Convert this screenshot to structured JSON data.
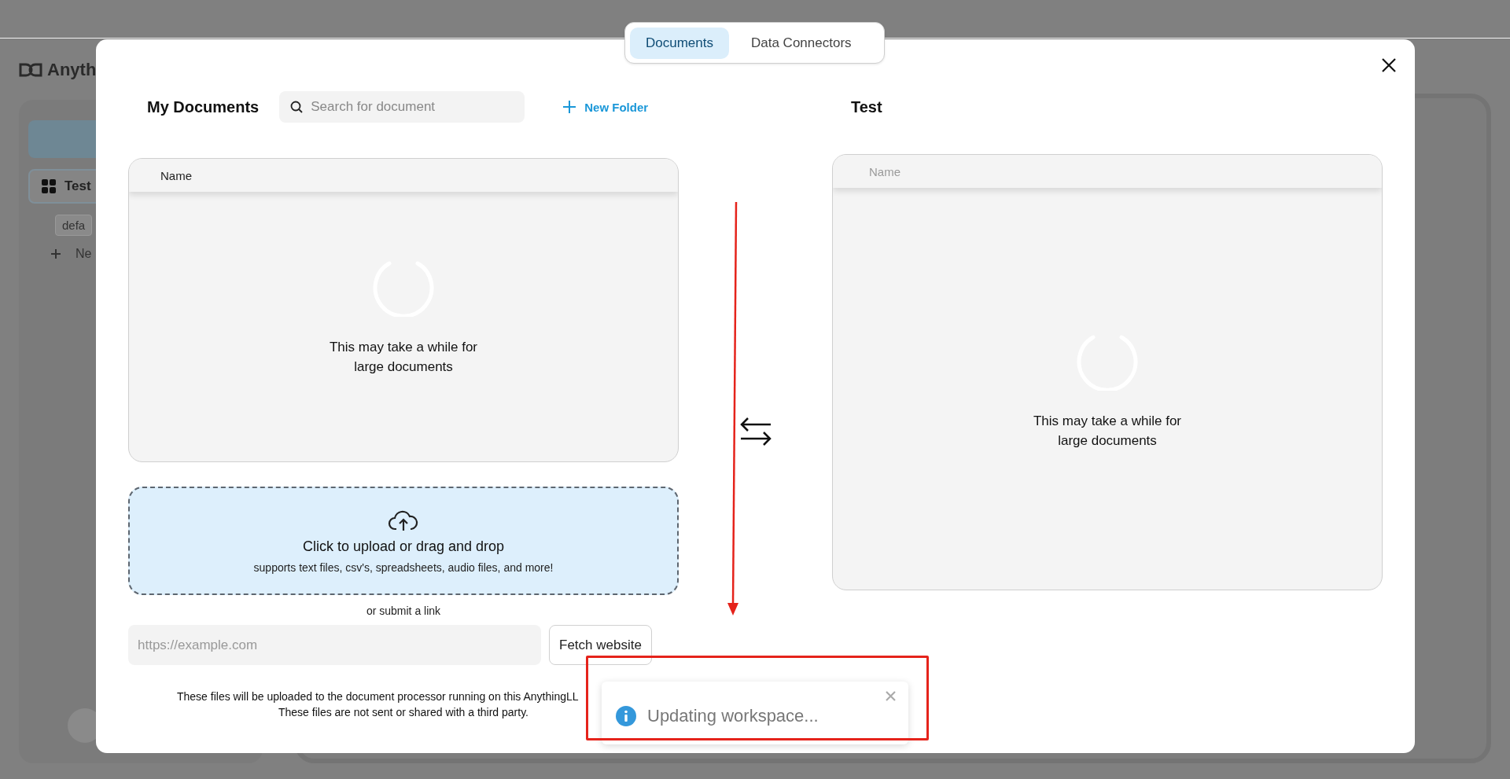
{
  "background": {
    "logo_text": "Anyth",
    "workspace": "Test",
    "thread": "defa",
    "new_thread": "Ne"
  },
  "tabs": [
    {
      "label": "Documents",
      "selected": true
    },
    {
      "label": "Data Connectors",
      "selected": false
    }
  ],
  "my_documents": {
    "title": "My Documents",
    "search": {
      "placeholder": "Search for document"
    },
    "new_folder": "New Folder",
    "table": {
      "columns": [
        "Name"
      ]
    },
    "loading_text": "This may take a while for large documents"
  },
  "workspace": {
    "title": "Test",
    "table": {
      "columns": [
        "Name"
      ]
    },
    "loading_text": "This may take a while for large documents"
  },
  "upload": {
    "title": "Click to upload or drag and drop",
    "subtitle": "supports text files, csv's, spreadsheets, audio files, and more!"
  },
  "link": {
    "label": "or submit a link",
    "placeholder": "https://example.com",
    "button": "Fetch website"
  },
  "footer": [
    "These files will be uploaded to the document processor running on this AnythingLL",
    "These files are not sent or shared with a third party."
  ],
  "toast": {
    "message": "Updating workspace..."
  }
}
